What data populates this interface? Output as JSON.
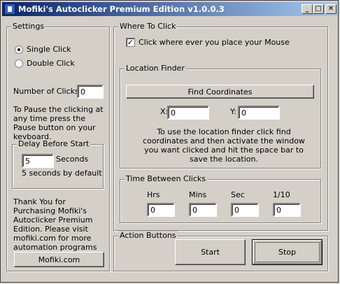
{
  "window": {
    "title": "Mofiki's Autoclicker Premium Edition v1.0.0.3",
    "minimize_glyph": "_",
    "maximize_glyph": "□",
    "close_glyph": "✕"
  },
  "settings": {
    "legend": "Settings",
    "single_click_label": "Single Click",
    "single_click_selected": true,
    "double_click_label": "Double Click",
    "double_click_selected": false,
    "clicks_label": "Number of Clicks:",
    "clicks_value": "0",
    "pause_text": "To Pause the clicking at any time press the Pause button on your keyboard.",
    "delay": {
      "legend": "Delay Before Start",
      "value": "5",
      "unit_label": "Seconds",
      "default_text": "5 seconds by default"
    },
    "thanks_text": "Thank You for Purchasing Mofiki's Autoclicker Premium Edition.  Please visit mofiki.com for more automation programs and macro's.",
    "site_button": "Mofiki.com"
  },
  "where": {
    "legend": "Where To Click",
    "checkbox_label": "Click where ever you place your Mouse",
    "checkbox_checked": true,
    "checkbox_glyph": "✓",
    "finder": {
      "legend": "Location Finder",
      "find_button": "Find Coordinates",
      "x_label": "X:",
      "x_value": "0",
      "y_label": "Y:",
      "y_value": "0",
      "help_text": "To use the location finder click find coordinates and then activate the window you want clicked and hit the space bar to save the location."
    }
  },
  "time": {
    "legend": "Time Between Clicks",
    "hrs_label": "Hrs",
    "hrs_value": "0",
    "mins_label": "Mins",
    "mins_value": "0",
    "sec_label": "Sec",
    "sec_value": "0",
    "tenth_label": "1/10",
    "tenth_value": "0"
  },
  "actions": {
    "legend": "Action Buttons",
    "start_label": "Start",
    "stop_label": "Stop"
  }
}
